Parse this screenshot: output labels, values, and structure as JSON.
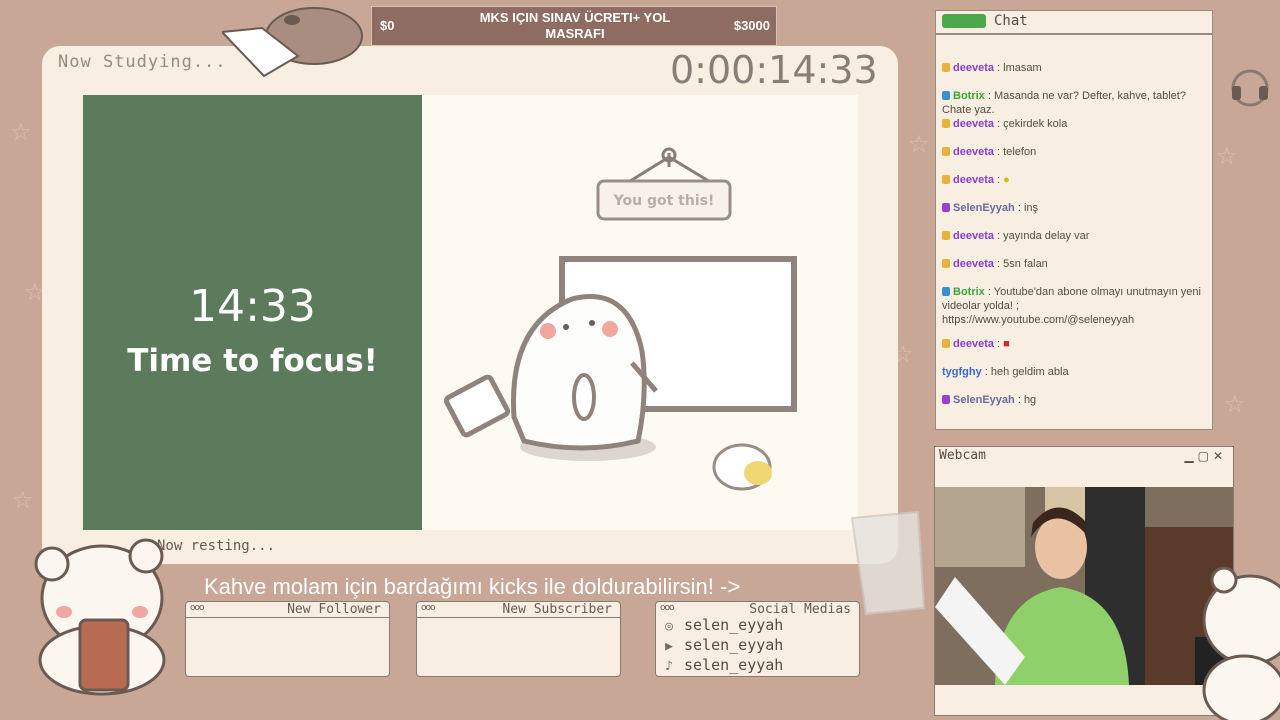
{
  "goal": {
    "low": "$0",
    "high": "$3000",
    "title": "MKS IÇIN SINAV ÜCRETI+ YOL MASRAFI"
  },
  "main": {
    "study_label": "Now Studying...",
    "clock": "0:00:14:33",
    "timer": {
      "time": "14:33",
      "message": "Time to focus!"
    },
    "sign_text": "You got this!",
    "rest_label": "Now resting..."
  },
  "ticker": "Kahve molam için bardağımı kicks ile doldurabilirsin! ->",
  "panels": {
    "follower_title": "New Follower",
    "subscriber_title": "New Subscriber",
    "social_title": "Social Medias",
    "dots": "ooo",
    "social": [
      {
        "icon": "instagram-icon",
        "handle": "selen_eyyah"
      },
      {
        "icon": "youtube-icon",
        "handle": "selen_eyyah"
      },
      {
        "icon": "tiktok-icon",
        "handle": "selen_eyyah"
      }
    ]
  },
  "chat": {
    "title": "Chat",
    "messages": [
      {
        "user": "deeveta",
        "text": ": lmasam",
        "color": "#8b3fd1",
        "badge": "#e8b23c"
      },
      {
        "user": "Botrix",
        "text": ": Masanda ne var? Defter, kahve, tablet? Chate yaz.",
        "color": "#3aa535",
        "badge": "#3a8fd1"
      },
      {
        "user": "deeveta",
        "text": ": çekirdek kola",
        "color": "#8b3fd1",
        "badge": "#e8b23c"
      },
      {
        "user": "deeveta",
        "text": ": telefon",
        "color": "#8b3fd1",
        "badge": "#e8b23c"
      },
      {
        "user": "deeveta",
        "text": ":",
        "color": "#8b3fd1",
        "badge": "#e8b23c"
      },
      {
        "user": "SelenEyyah",
        "text": ": inş",
        "color": "#6a6aa0",
        "badge": "#9a3fd1"
      },
      {
        "user": "deeveta",
        "text": ": yayında delay var",
        "color": "#8b3fd1",
        "badge": "#e8b23c"
      },
      {
        "user": "deeveta",
        "text": ": 5sn falan",
        "color": "#8b3fd1",
        "badge": "#e8b23c"
      },
      {
        "user": "Botrix",
        "text": ": Youtube'dan abone olmayı unutmayın yeni videolar yolda! ; https://www.youtube.com/@seleneyyah",
        "color": "#3aa535",
        "badge": "#3a8fd1"
      },
      {
        "user": "deeveta",
        "text": ":",
        "color": "#8b3fd1",
        "badge": "#e8b23c"
      },
      {
        "user": "tygfghy",
        "text": ": heh geldim abla",
        "color": "#3a6ad1",
        "badge": ""
      },
      {
        "user": "SelenEyyah",
        "text": ": hg",
        "color": "#6a6aa0",
        "badge": "#9a3fd1"
      }
    ]
  },
  "webcam": {
    "title": "Webcam",
    "buttons": "▁▢✕"
  },
  "colors": {
    "background": "#c9a797",
    "panel": "#f8eee1",
    "timer_green": "#5c7a5c"
  }
}
